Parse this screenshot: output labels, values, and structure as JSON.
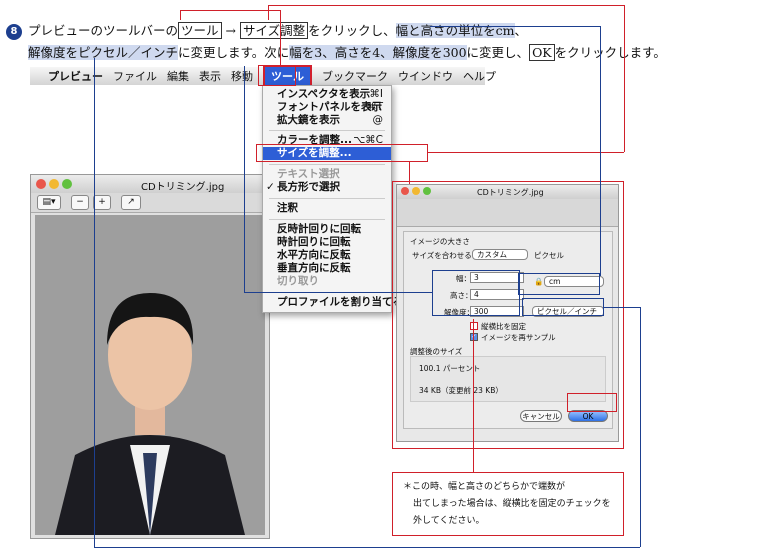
{
  "step": {
    "number": "8",
    "line1_a": "プレビューのツールバーの",
    "tool_box": "ツール",
    "arrow": "→",
    "size_box": "サイズ調整",
    "line1_b": "をクリックし、",
    "line1_hl": "幅と高さの単位をcm",
    "line1_c": "、",
    "line2_hl": "解像度をピクセル／インチ",
    "line2_a": "に変更します。次に",
    "line2_hl2": "幅を3、高さを4、解像度を300",
    "line2_b": "に変更し、",
    "ok_box": "OK",
    "line2_c": "をクリックします。"
  },
  "menubar": {
    "apple": "",
    "items": [
      "プレビュー",
      "ファイル",
      "編集",
      "表示",
      "移動",
      "ツール",
      "ブックマーク",
      "ウインドウ",
      "ヘルプ"
    ]
  },
  "tools_menu": {
    "inspector": "インスペクタを表示",
    "inspector_sc": "⌘I",
    "font_panel": "フォントパネルを表示",
    "font_panel_sc": "⌘T",
    "magnifier": "拡大鏡を表示",
    "magnifier_sc": "@",
    "adjust_color": "カラーを調整...",
    "adjust_color_sc": "⌥⌘C",
    "adjust_size": "サイズを調整...",
    "text_select": "テキスト選択",
    "rect_select": "長方形で選択",
    "rect_check": "✓",
    "annotate": "注釈",
    "rotate_left": "反時計回りに回転",
    "rotate_right": "時計回りに回転",
    "flip_h": "水平方向に反転",
    "flip_v": "垂直方向に反転",
    "crop": "切り取り",
    "assign_profile": "プロファイルを割り当てる..."
  },
  "left_window": {
    "title": "CDトリミング.jpg"
  },
  "dialog": {
    "title": "CDトリミング.jpg",
    "section_size": "イメージの大きさ",
    "fit_label": "サイズを合わせる：",
    "fit_value": "カスタム",
    "fit_unit": "ピクセル",
    "width_label": "幅：",
    "width_value": "3",
    "height_label": "高さ：",
    "height_value": "4",
    "res_label": "解像度：",
    "res_value": "300",
    "unit_value": "cm",
    "res_unit_value": "ピクセル／インチ",
    "keep_ratio": "縦横比を固定",
    "resample": "イメージを再サンプル",
    "section_result": "調整後のサイズ",
    "percent": "100.1 パーセント",
    "filesize": "34 KB（変更前 23 KB）",
    "cancel": "キャンセル",
    "ok": "OK"
  },
  "note": {
    "line1": "＊この時、幅と高さのどちらかで端数が",
    "line2": "出てしまった場合は、縦横比を固定のチェックを",
    "line3": "外してください。"
  }
}
